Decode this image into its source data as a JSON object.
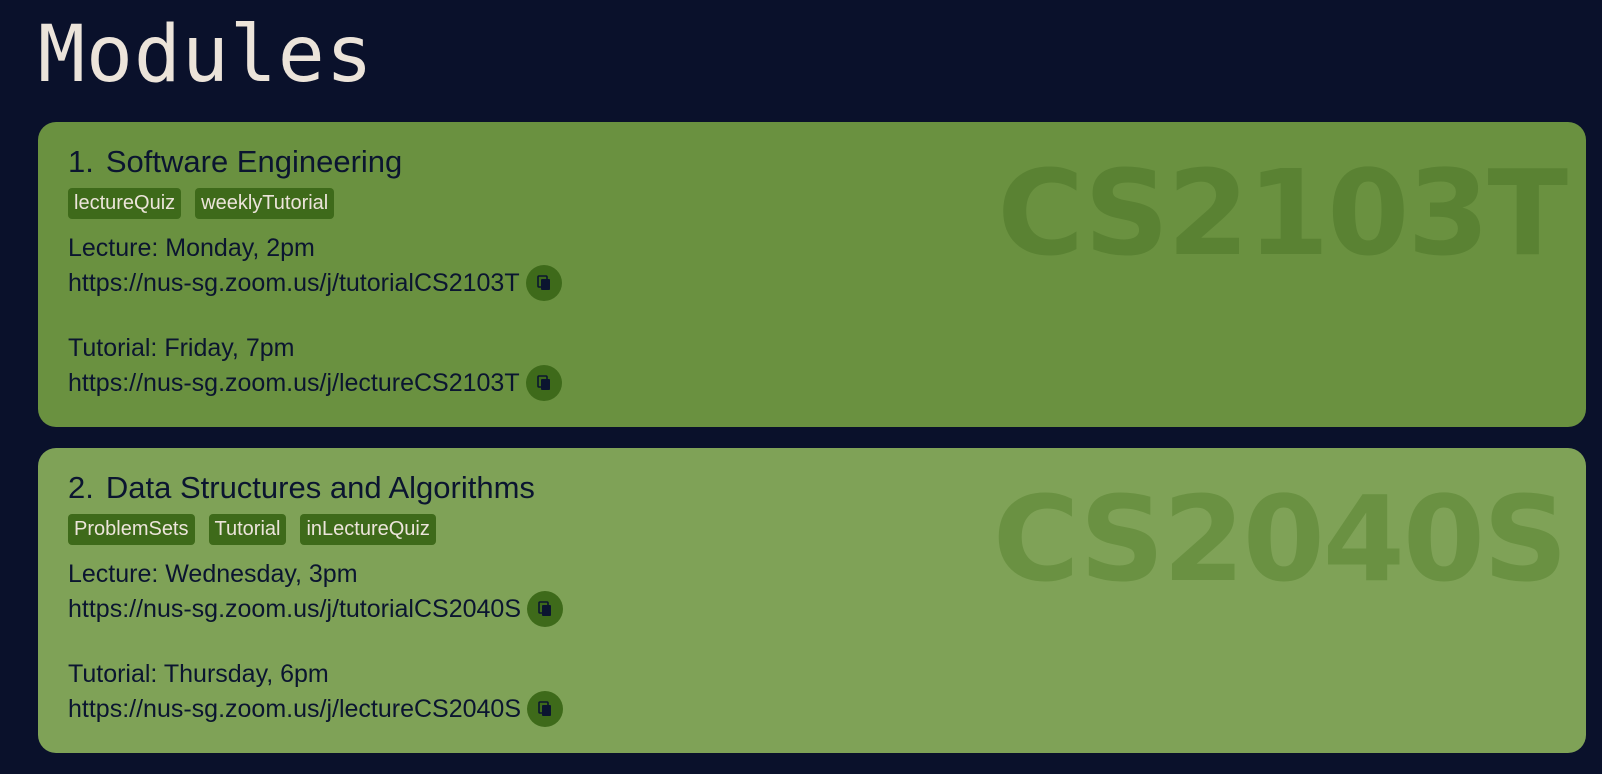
{
  "page_title": "Modules",
  "colors": {
    "background": "#0a112b",
    "card_1": "#6a9140",
    "card_2": "#7fa257",
    "tag_bg": "#3e6a1a",
    "title_text": "#ece4da",
    "body_text": "#0b1530"
  },
  "icons": {
    "copy": "copy-icon"
  },
  "modules": [
    {
      "index": "1.",
      "name": "Software Engineering",
      "code": "CS2103T",
      "tags": [
        "lectureQuiz",
        "weeklyTutorial"
      ],
      "lecture": {
        "time": "Lecture: Monday, 2pm",
        "link": "https://nus-sg.zoom.us/j/tutorialCS2103T"
      },
      "tutorial": {
        "time": "Tutorial: Friday, 7pm",
        "link": "https://nus-sg.zoom.us/j/lectureCS2103T"
      }
    },
    {
      "index": "2.",
      "name": "Data Structures and Algorithms",
      "code": "CS2040S",
      "tags": [
        "ProblemSets",
        "Tutorial",
        "inLectureQuiz"
      ],
      "lecture": {
        "time": "Lecture: Wednesday, 3pm",
        "link": "https://nus-sg.zoom.us/j/tutorialCS2040S"
      },
      "tutorial": {
        "time": "Tutorial: Thursday, 6pm",
        "link": "https://nus-sg.zoom.us/j/lectureCS2040S"
      }
    }
  ]
}
